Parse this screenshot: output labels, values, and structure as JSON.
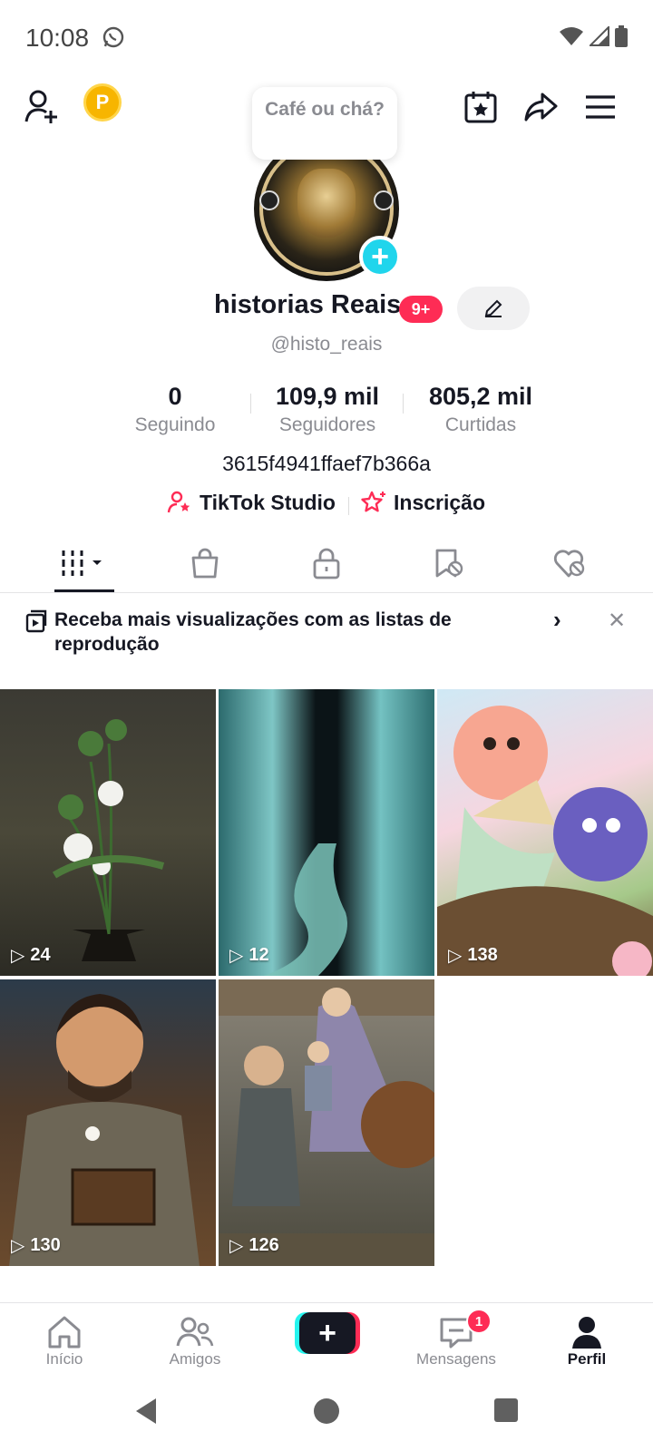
{
  "status_bar": {
    "time": "10:08"
  },
  "top_bar": {
    "coin_letter": "P",
    "bubble_text": "Café ou chá?"
  },
  "profile": {
    "name": "historias Reais",
    "notification_badge": "9+",
    "handle": "@histo_reais",
    "bio": "3615f4941ffaef7b366a"
  },
  "stats": [
    {
      "value": "0",
      "label": "Seguindo"
    },
    {
      "value": "109,9 mil",
      "label": "Seguidores"
    },
    {
      "value": "805,2 mil",
      "label": "Curtidas"
    }
  ],
  "links": {
    "studio": "TikTok Studio",
    "subscription": "Inscrição"
  },
  "banner": {
    "text": "Receba mais visualizações com as listas de reprodução"
  },
  "videos": [
    {
      "views": "24"
    },
    {
      "views": "12"
    },
    {
      "views": "138"
    },
    {
      "views": "130"
    },
    {
      "views": "126"
    }
  ],
  "bottom_nav": {
    "home": "Início",
    "friends": "Amigos",
    "messages": "Mensagens",
    "messages_badge": "1",
    "profile": "Perfil",
    "create": "+"
  },
  "colors": {
    "accent": "#fe2c55",
    "cyan": "#25f4ee",
    "text": "#161823",
    "muted": "#8a8b91"
  }
}
